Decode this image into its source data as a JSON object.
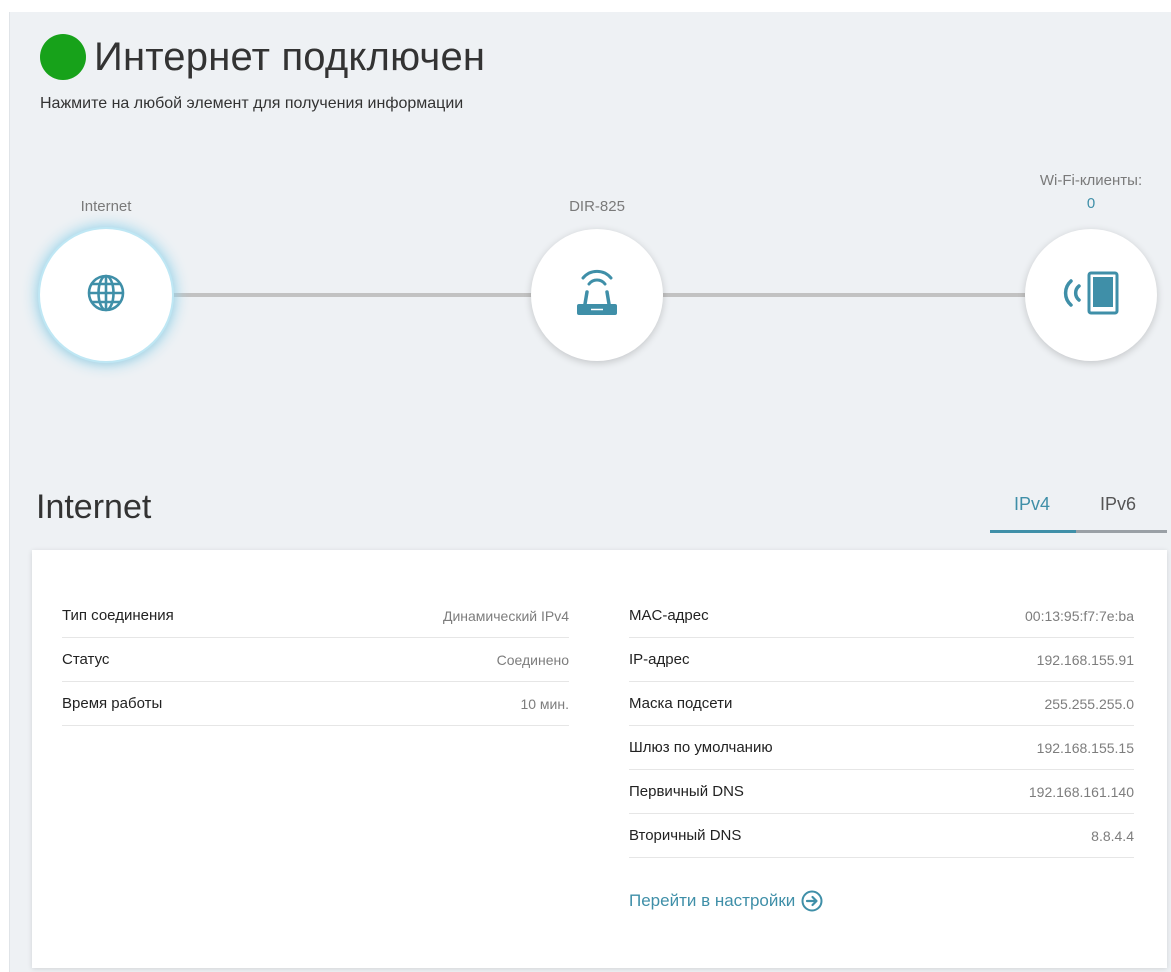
{
  "status": {
    "title": "Интернет подключен",
    "hint": "Нажмите на любой элемент для получения информации",
    "indicator_color": "#17a21a"
  },
  "topology": {
    "internet": {
      "label": "Internet",
      "icon": "globe-icon"
    },
    "router": {
      "label": "DIR-825",
      "icon": "router-icon"
    },
    "wifi_clients": {
      "label": "Wi-Fi-клиенты:",
      "count": "0",
      "icon": "wifi-tablet-icon"
    }
  },
  "section": {
    "title": "Internet",
    "tabs": [
      {
        "label": "IPv4",
        "active": true
      },
      {
        "label": "IPv6",
        "active": false
      }
    ]
  },
  "info": {
    "left": [
      {
        "label": "Тип соединения",
        "value": "Динамический IPv4"
      },
      {
        "label": "Статус",
        "value": "Соединено"
      },
      {
        "label": "Время работы",
        "value": "10 мин."
      }
    ],
    "right": [
      {
        "label": "MAC-адрес",
        "value": "00:13:95:f7:7e:ba"
      },
      {
        "label": "IP-адрес",
        "value": "192.168.155.91"
      },
      {
        "label": "Маска подсети",
        "value": "255.255.255.0"
      },
      {
        "label": "Шлюз по умолчанию",
        "value": "192.168.155.15"
      },
      {
        "label": "Первичный DNS",
        "value": "192.168.161.140"
      },
      {
        "label": "Вторичный DNS",
        "value": "8.8.4.4"
      }
    ],
    "settings_link": "Перейти в настройки"
  },
  "colors": {
    "accent": "#3f8fa8",
    "background": "#eef1f4"
  }
}
